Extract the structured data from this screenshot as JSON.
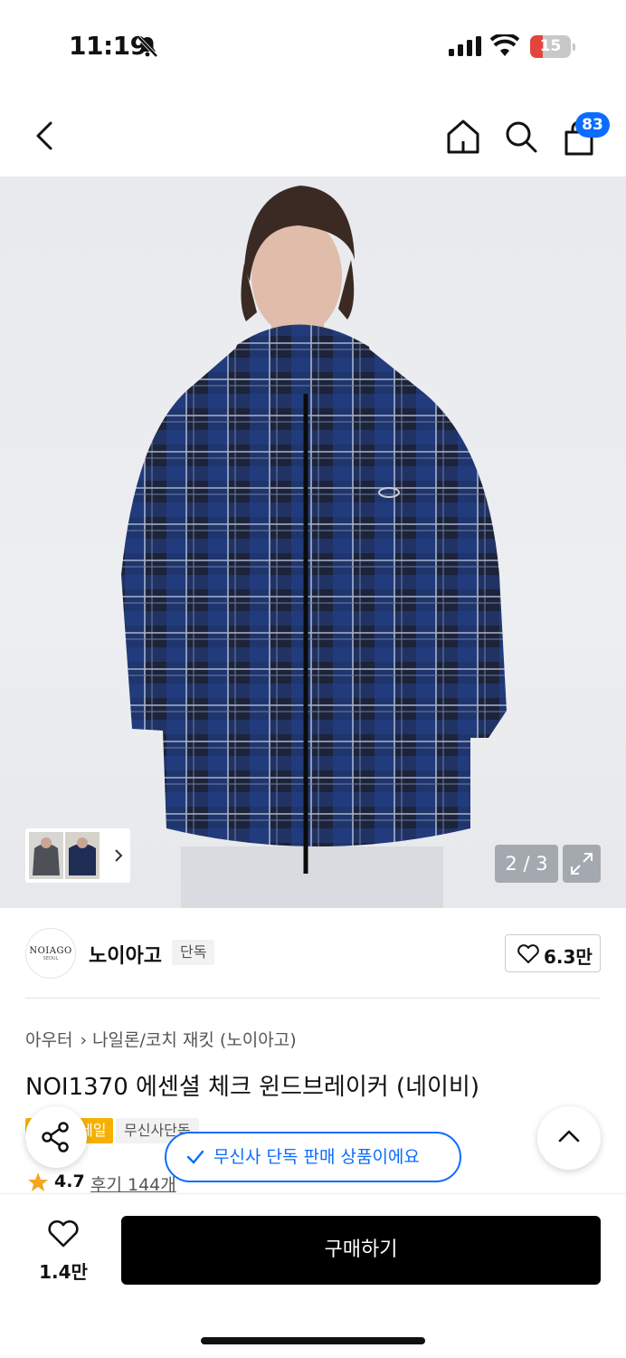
{
  "status": {
    "time": "11:19",
    "battery": "15",
    "icons": [
      "bell-slash-icon",
      "signal-icon",
      "wifi-icon",
      "battery-icon"
    ]
  },
  "nav": {
    "icons": [
      "back-icon",
      "home-icon",
      "search-icon",
      "cart-icon"
    ],
    "cart_count": "83"
  },
  "gallery": {
    "counter": "2 / 3",
    "current_index": 2,
    "total": 3,
    "icons": [
      "chevron-right-icon",
      "expand-icon"
    ]
  },
  "brand": {
    "logo_text": "NOIAGO",
    "logo_subtext": "SEOUL",
    "name": "노이아고",
    "tag": "단독",
    "likes": "6.3만"
  },
  "product": {
    "breadcrumb": [
      "아우터",
      "나일론/코치 재킷 (노이아고)"
    ],
    "title": "NOI1370 에센셜 체크 윈드브레이커 (네이비)",
    "promo_tag": "세일",
    "exclusive_badge": "무신사단독",
    "rating": "4.7",
    "reviews": "후기 144개"
  },
  "toast": {
    "text": "무신사 단독 판매 상품이에요"
  },
  "bottom": {
    "likes": "1.4만",
    "buy_label": "구매하기"
  },
  "colors": {
    "accent": "#0b6cff",
    "promo": "#f6b100",
    "star": "#f5a623",
    "buy_button": "#000000"
  }
}
